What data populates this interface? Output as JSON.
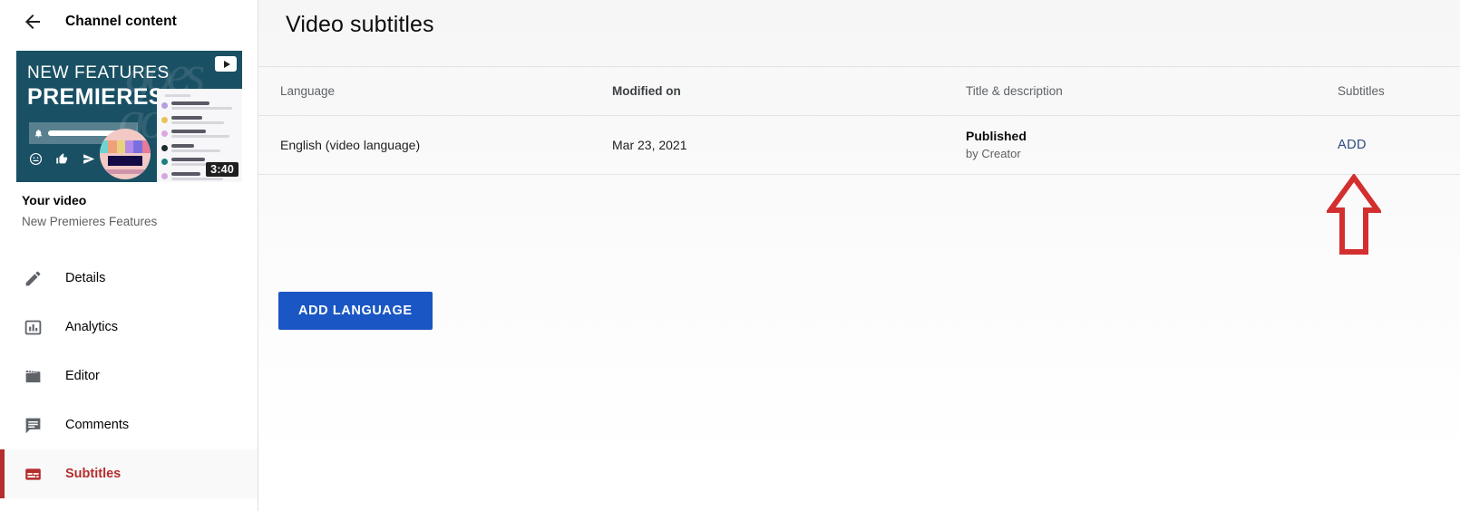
{
  "sidebar": {
    "back_icon": "back-arrow-icon",
    "header_title": "Channel content",
    "thumbnail": {
      "line1": "NEW FEATURES",
      "line2": "PREMIERES",
      "duration": "3:40",
      "badge_icon": "youtube-play-icon",
      "bell_icon": "bell-icon",
      "social_icons": [
        "emoji-icon",
        "thumbs-up-icon",
        "share-icon"
      ],
      "script_text": "goes",
      "chat_dot_colors": [
        "#b79ee0",
        "#e8c35a",
        "#dba8e3",
        "#1b2b2b",
        "#1d8080",
        "#d7a8e0",
        "#e8d48a",
        "#1b1b1b",
        "#9fd6d6"
      ],
      "bg_color": "#1a5064",
      "avatar_colors": [
        "#6fd3cf",
        "#f0a07a",
        "#e8d27a",
        "#b48be8",
        "#7a6fe0",
        "#e87a9a"
      ]
    },
    "video_title": "Your video",
    "video_subtitle": "New Premieres Features",
    "nav_items": [
      {
        "label": "Details",
        "icon": "pencil-icon",
        "active": false
      },
      {
        "label": "Analytics",
        "icon": "bar-chart-icon",
        "active": false
      },
      {
        "label": "Editor",
        "icon": "clapperboard-icon",
        "active": false
      },
      {
        "label": "Comments",
        "icon": "comment-icon",
        "active": false
      },
      {
        "label": "Subtitles",
        "icon": "subtitles-icon",
        "active": true
      }
    ],
    "active_color": "#b52d2d"
  },
  "main": {
    "page_title": "Video subtitles",
    "table": {
      "columns": [
        {
          "key": "language",
          "label": "Language",
          "bold": false
        },
        {
          "key": "modified",
          "label": "Modified on",
          "bold": true
        },
        {
          "key": "title_desc",
          "label": "Title & description",
          "bold": false
        },
        {
          "key": "subtitles",
          "label": "Subtitles",
          "bold": false
        }
      ],
      "rows": [
        {
          "language": "English (video language)",
          "modified": "Mar 23, 2021",
          "title_status": "Published",
          "title_by": "by Creator",
          "subtitles_action": "ADD"
        }
      ]
    },
    "add_language_button": "ADD LANGUAGE",
    "button_color": "#1a56c4",
    "link_color": "#2b4a7e"
  },
  "annotation": {
    "type": "arrow-up",
    "color": "#d32f2f",
    "points_to": "ADD"
  }
}
